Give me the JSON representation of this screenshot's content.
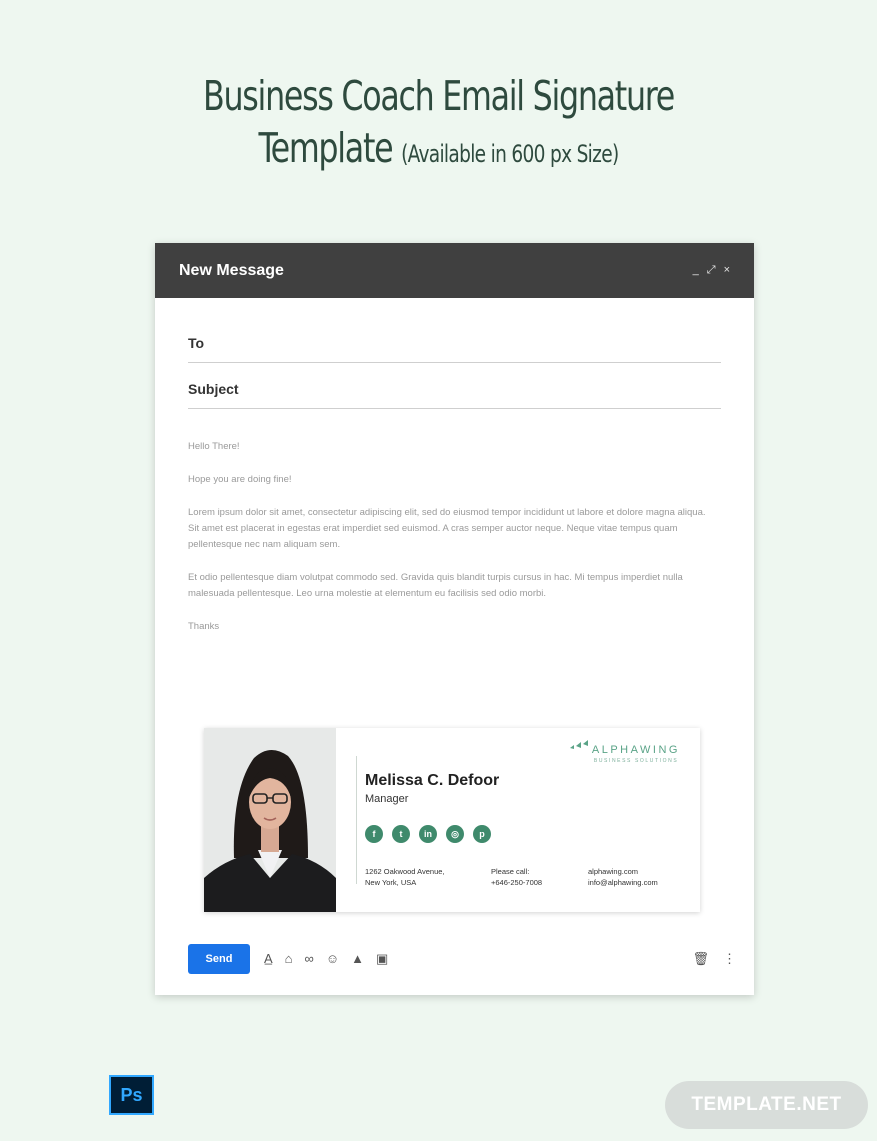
{
  "page": {
    "title_line1": "Business Coach Email Signature",
    "title_line2": "Template",
    "title_note": "(Available in 600 px Size)"
  },
  "compose": {
    "header_title": "New Message",
    "controls": {
      "minimize": "_",
      "expand": "⤢",
      "close": "×"
    },
    "to_label": "To",
    "subject_label": "Subject",
    "body": {
      "greeting": "Hello There!",
      "line2": "Hope you are doing fine!",
      "para1": "Lorem ipsum dolor sit amet, consectetur adipiscing elit, sed do eiusmod tempor incididunt ut labore et dolore magna aliqua. Sit amet est placerat in egestas erat imperdiet sed euismod. A cras semper auctor neque. Neque vitae tempus quam pellentesque nec nam aliquam sem.",
      "para2": " Et odio pellentesque diam volutpat commodo sed. Gravida quis blandit turpis cursus in hac. Mi tempus imperdiet nulla malesuada pellentesque. Leo urna molestie at elementum eu facilisis sed odio morbi.",
      "closing": "Thanks"
    },
    "send_label": "Send"
  },
  "signature": {
    "name": "Melissa C. Defoor",
    "role": "Manager",
    "logo_name": "ALPHAWING",
    "logo_sub": "BUSINESS SOLUTIONS",
    "social": [
      "f",
      "t",
      "in",
      "◎",
      "p"
    ],
    "address_line1": "1262 Oakwood Avenue,",
    "address_line2": "New York, USA",
    "phone_label": "Please call:",
    "phone": "+646-250-7008",
    "website": "alphawing.com",
    "email": "info@alphawing.com",
    "accent": "#3f8a6c"
  },
  "footer_badges": {
    "ps": "Ps",
    "brand": "TEMPLATE.NET"
  },
  "colors": {
    "background": "#eef7f0",
    "header": "#404040",
    "send": "#1a73e8",
    "title": "#2e4a3e"
  }
}
